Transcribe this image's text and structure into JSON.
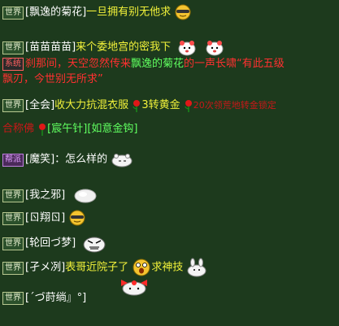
{
  "badges": {
    "world": "世界",
    "system": "系统",
    "clan": "帮派"
  },
  "messages": [
    {
      "speaker": "[飘逸的菊花]",
      "text": "一旦拥有别无他求"
    },
    {
      "speaker": "[苗苗苗苗]",
      "text": "来个委地宫的密我下"
    },
    {
      "sys_text1": "刹那间，天空忽然传来",
      "sys_name": "飘逸的菊花",
      "sys_text2": "的一声长啸“有此五级",
      "sys_text3": "飘刃，今世别无所求”"
    },
    {
      "speaker": "[全会]",
      "text": "收大力抗混衣服",
      "text2": "3转黄金",
      "text3": "20次领荒地转金锁定",
      "text4": "合称佛",
      "item1": "[宸午针]",
      "item2": "[如意金钩]"
    },
    {
      "speaker": "[魔笑]",
      "text": "：怎么样的"
    },
    {
      "speaker": "[我之邪]",
      "text": ""
    },
    {
      "speaker": "[ㄖ翔ㄖ]",
      "text": ""
    },
    {
      "speaker": "[轮回づ梦]",
      "text": ""
    },
    {
      "speaker": "[孑メ冽]",
      "text": "表哥近院子了",
      "text2": "求神技"
    },
    {
      "speaker": "[ˊづ莳绱』°]",
      "text": ""
    }
  ],
  "colors": {
    "background": "#1d3a1d",
    "speaker": "#ffffff",
    "message": "#f2f23a",
    "system": "#ff3030",
    "item": "#60ff60"
  }
}
